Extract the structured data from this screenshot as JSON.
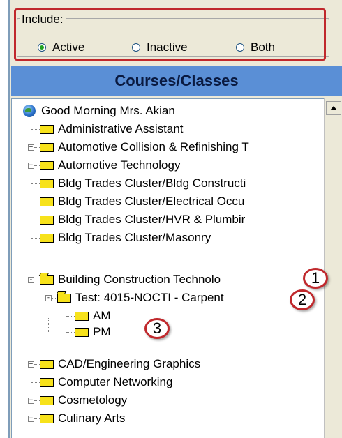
{
  "include": {
    "legend": "Include:",
    "options": [
      {
        "label": "Active",
        "checked": true
      },
      {
        "label": "Inactive",
        "checked": false
      },
      {
        "label": "Both",
        "checked": false
      }
    ]
  },
  "panel": {
    "title": "Courses/Classes"
  },
  "tree": {
    "root": "Good Morning Mrs. Akian",
    "items": [
      "Administrative Assistant",
      "Automotive Collision &  Refinishing T",
      "Automotive Technology",
      "Bldg Trades Cluster/Bldg Constructi",
      "Bldg Trades Cluster/Electrical Occu",
      "Bldg Trades Cluster/HVR & Plumbir",
      "Bldg Trades Cluster/Masonry",
      "Building Construction Technolo",
      "Test: 4015-NOCTI - Carpent",
      "AM",
      "PM",
      "CAD/Engineering Graphics",
      "Computer Networking",
      "Cosmetology",
      "Culinary Arts"
    ]
  },
  "callouts": [
    "1",
    "2",
    "3"
  ],
  "colors": {
    "highlight": "#c0282c",
    "header_bg": "#5a8fd6",
    "folder": "#f7e21b",
    "radio_dot": "#21a121"
  },
  "icons": {
    "root": "globe-icon",
    "node": "folder-icon",
    "expander_plus": "+",
    "expander_minus": "-"
  }
}
